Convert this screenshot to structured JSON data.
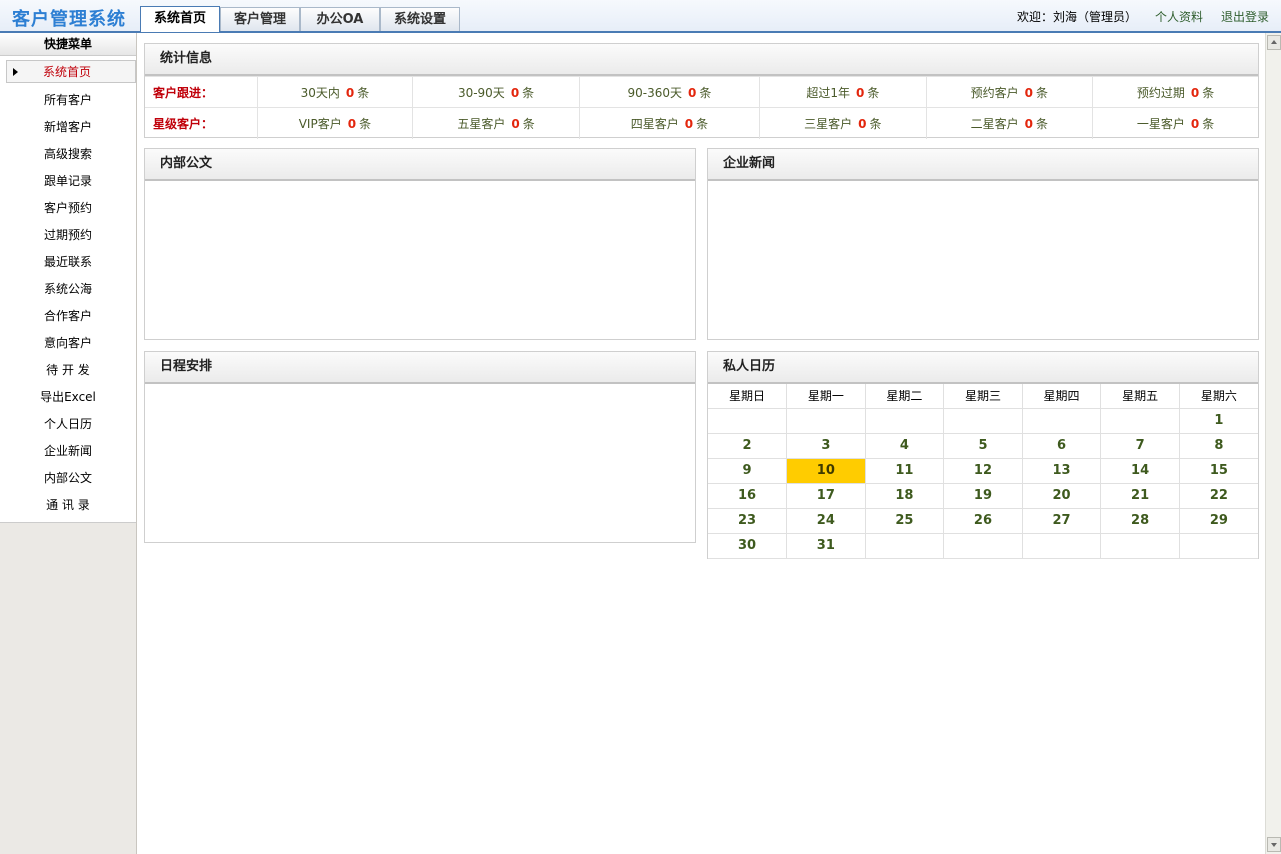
{
  "header": {
    "app_title": "客户管理系统",
    "tabs": [
      {
        "label": "系统首页",
        "active": true
      },
      {
        "label": "客户管理",
        "active": false
      },
      {
        "label": "办公OA",
        "active": false
      },
      {
        "label": "系统设置",
        "active": false
      }
    ],
    "welcome": "欢迎：刘海（管理员）",
    "profile_link": "个人资料",
    "logout_link": "退出登录"
  },
  "sidebar": {
    "title": "快捷菜单",
    "items": [
      {
        "label": "系统首页",
        "active": true
      },
      {
        "label": "所有客户"
      },
      {
        "label": "新增客户"
      },
      {
        "label": "高级搜索"
      },
      {
        "label": "跟单记录"
      },
      {
        "label": "客户预约"
      },
      {
        "label": "过期预约"
      },
      {
        "label": "最近联系"
      },
      {
        "label": "系统公海"
      },
      {
        "label": "合作客户"
      },
      {
        "label": "意向客户"
      },
      {
        "label": "待 开 发"
      },
      {
        "label": "导出Excel"
      },
      {
        "label": "个人日历"
      },
      {
        "label": "企业新闻"
      },
      {
        "label": "内部公文"
      },
      {
        "label": "通 讯 录"
      }
    ]
  },
  "stats": {
    "title": "统计信息",
    "unit": "条",
    "rows": [
      {
        "label": "客户跟进：",
        "cells": [
          {
            "name": "30天内",
            "count": "0"
          },
          {
            "name": "30-90天",
            "count": "0"
          },
          {
            "name": "90-360天",
            "count": "0"
          },
          {
            "name": "超过1年",
            "count": "0"
          },
          {
            "name": "预约客户",
            "count": "0"
          },
          {
            "name": "预约过期",
            "count": "0"
          }
        ]
      },
      {
        "label": "星级客户：",
        "cells": [
          {
            "name": "VIP客户",
            "count": "0"
          },
          {
            "name": "五星客户",
            "count": "0"
          },
          {
            "name": "四星客户",
            "count": "0"
          },
          {
            "name": "三星客户",
            "count": "0"
          },
          {
            "name": "二星客户",
            "count": "0"
          },
          {
            "name": "一星客户",
            "count": "0"
          }
        ]
      }
    ]
  },
  "panels": {
    "docs_title": "内部公文",
    "news_title": "企业新闻",
    "schedule_title": "日程安排",
    "calendar_title": "私人日历"
  },
  "calendar": {
    "weekdays": [
      "星期日",
      "星期一",
      "星期二",
      "星期三",
      "星期四",
      "星期五",
      "星期六"
    ],
    "today": "10",
    "weeks": [
      [
        "",
        "",
        "",
        "",
        "",
        "",
        "1"
      ],
      [
        "2",
        "3",
        "4",
        "5",
        "6",
        "7",
        "8"
      ],
      [
        "9",
        "10",
        "11",
        "12",
        "13",
        "14",
        "15"
      ],
      [
        "16",
        "17",
        "18",
        "19",
        "20",
        "21",
        "22"
      ],
      [
        "23",
        "24",
        "25",
        "26",
        "27",
        "28",
        "29"
      ],
      [
        "30",
        "31",
        "",
        "",
        "",
        "",
        ""
      ]
    ]
  }
}
